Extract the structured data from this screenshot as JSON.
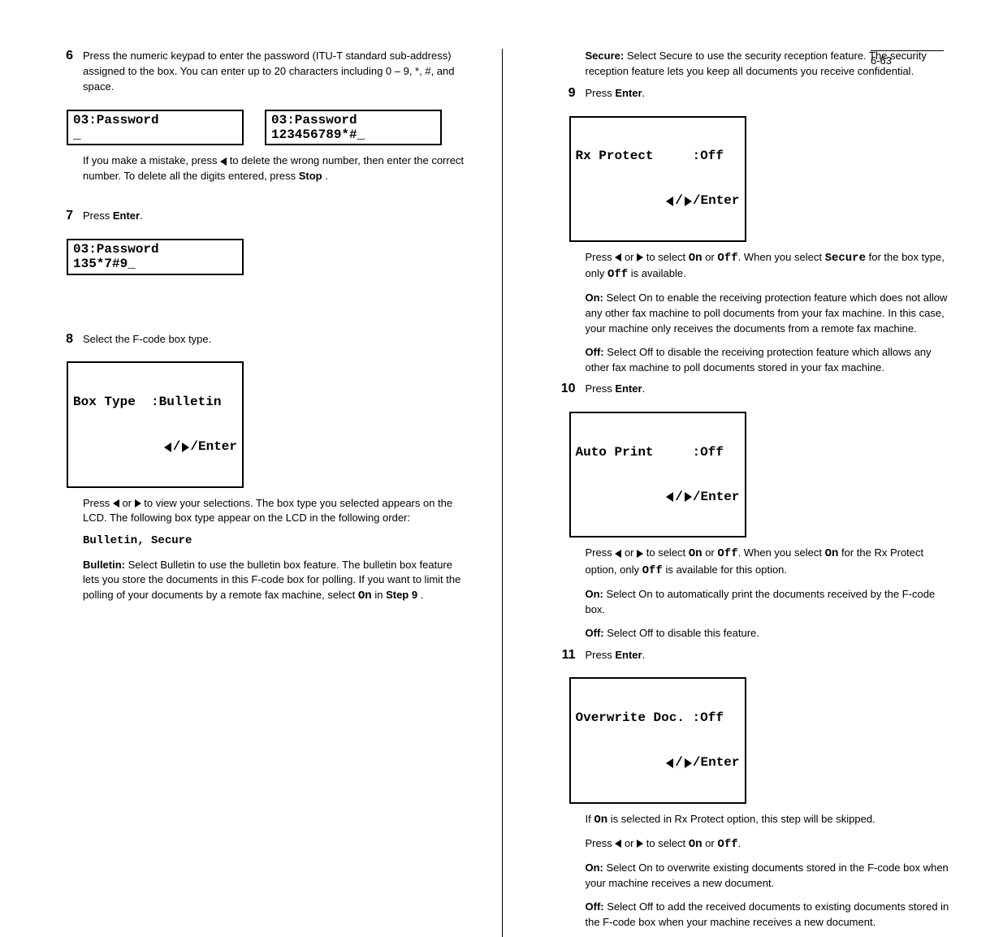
{
  "page_number": "6-63",
  "left_col": {
    "step6": {
      "num": "6",
      "text_a": "Press the numeric keypad to enter the password (ITU-T standard sub-address) assigned to the box. You can enter up to 20 characters including 0 – 9, *, #, and space.",
      "lcd_empty": "03:Password\n_",
      "lcd_full": "03:Password\n123456789*#_",
      "note_pre": "If you make a mistake, press ",
      "note_mid": " to delete the wrong number, then enter the correct number. To delete all the digits entered, press ",
      "note_end": "."
    },
    "step7": {
      "num": "7",
      "text_a": "Press ",
      "text_b": ".",
      "lcd": "03:Password\n135*7#9_"
    },
    "step8": {
      "num": "8",
      "text_a": "Select the F-code box type.",
      "lcd_line1": "Box Type  :Bulletin",
      "note": "Press  or  to view your selections. The box type you selected appears on the LCD. The following box type appear on the LCD in the following order:",
      "options": "Bulletin, Secure",
      "bulletin_label": "Bulletin:",
      "bulletin_desc": "Select Bulletin to use the bulletin box feature. The bulletin box feature lets you store the documents in this F-code box for polling. If you want to limit the polling of your documents by a remote fax machine, select ",
      "bulletin_on": "On",
      "bulletin_in": " in ",
      "bulletin_step": "Step 9",
      "bulletin_end": "."
    },
    "stop_btn": "Stop",
    "enter_btn": "Enter",
    "arrow_enter": "/Enter"
  },
  "right_col": {
    "secure_label": "Secure:",
    "secure_desc": "Select Secure to use the security reception feature. The security reception feature lets you keep all documents you receive confidential.",
    "step9": {
      "num": "9",
      "text_a": "Press ",
      "text_b": ".",
      "lcd_line1": "Rx Protect     :Off",
      "note1": "Press  or  to select On or Off. When you select Secure for the box type, only Off is available.",
      "on_label": "On:",
      "on_desc": "Select On to enable the receiving protection feature which does not allow any other fax machine to poll documents from your fax machine. In this case, your machine only receives the documents from a remote fax machine.",
      "off_label": "Off:",
      "off_desc": "Select Off to disable the receiving protection feature which allows any other fax machine to poll documents stored in your fax machine."
    },
    "step10": {
      "num": "10",
      "text_a": "Press ",
      "text_b": ".",
      "lcd_line1": "Auto Print     :Off",
      "note1": "Press  or  to select On or Off. When you select On for the Rx Protect option, only Off is available for this option.",
      "on_label": "On:",
      "on_desc": "Select On to automatically print the documents received by the F-code box.",
      "off_label": "Off:",
      "off_desc": "Select Off to disable this feature."
    },
    "step11": {
      "num": "11",
      "text_a": "Press ",
      "text_b": ".",
      "lcd_line1": "Overwrite Doc. :Off",
      "note1_a": "If ",
      "note1_b": " is selected in Rx Protect option, this step will be skipped.",
      "note2": "Press  or  to select On or Off.",
      "on_label": "On:",
      "on_desc": "Select On to overwrite existing documents stored in the F-code box when your machine receives a new document.",
      "off_label": "Off:",
      "off_desc": "Select Off to add the received documents to existing documents stored in the F-code box when your machine receives a new document.",
      "on_word": "On"
    },
    "enter_btn": "Enter",
    "arrow_enter": "/Enter"
  }
}
